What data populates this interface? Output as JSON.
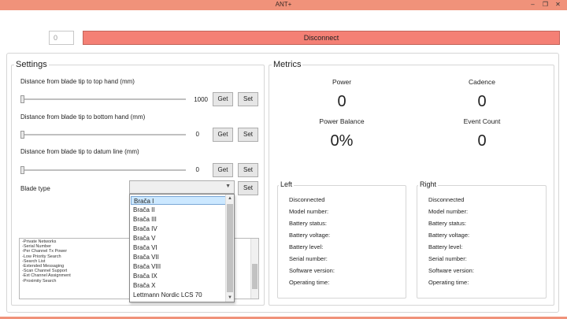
{
  "window": {
    "title": "ANT+"
  },
  "top": {
    "channel_value": "0",
    "disconnect_label": "Disconnect"
  },
  "settings": {
    "title": "Settings",
    "top_hand": {
      "label": "Distance from blade tip to top hand (mm)",
      "value": "1000",
      "slider_level": 0.0
    },
    "bottom_hand": {
      "label": "Distance from blade tip to bottom hand (mm)",
      "value": "0",
      "slider_level": 0.0
    },
    "datum_line": {
      "label": "Distance from blade tip to datum line (mm)",
      "value": "0",
      "slider_level": 0.0
    },
    "get_label": "Get",
    "set_label": "Set",
    "blade_type": {
      "label": "Blade type",
      "selected": "",
      "options": [
        "Brača I",
        "Brača II",
        "Brača III",
        "Brača IV",
        "Brača V",
        "Brača VI",
        "Brača VII",
        "Brača VIII",
        "Brača IX",
        "Brača X",
        "Lettmann Nordic LCS 70"
      ]
    },
    "capabilities": [
      "-Private Networks",
      "-Serial Number",
      "-Per Channel Tx Power",
      "-Low Priority Search",
      "-Search List",
      "-Extended Messaging",
      "-Scan Channel Support",
      "-Ext Channel Assignment",
      "-Proximity Search"
    ]
  },
  "metrics": {
    "title": "Metrics",
    "power": {
      "label": "Power",
      "value": "0"
    },
    "cadence": {
      "label": "Cadence",
      "value": "0"
    },
    "power_balance": {
      "label": "Power Balance",
      "value": "0%"
    },
    "event_count": {
      "label": "Event Count",
      "value": "0"
    },
    "left": {
      "title": "Left",
      "lines": [
        "Disconnected",
        "Model number:",
        "Battery status:",
        "Battery voltage:",
        "Battery level:",
        "Serial number:",
        "Software version:",
        "Operating time:"
      ]
    },
    "right": {
      "title": "Right",
      "lines": [
        "Disconnected",
        "Model number:",
        "Battery status:",
        "Battery voltage:",
        "Battery level:",
        "Serial number:",
        "Software version:",
        "Operating time:"
      ]
    }
  },
  "colors": {
    "titlebar": "#f0927a",
    "disconnect": "#f48075",
    "selected_item": "#cce8ff"
  }
}
